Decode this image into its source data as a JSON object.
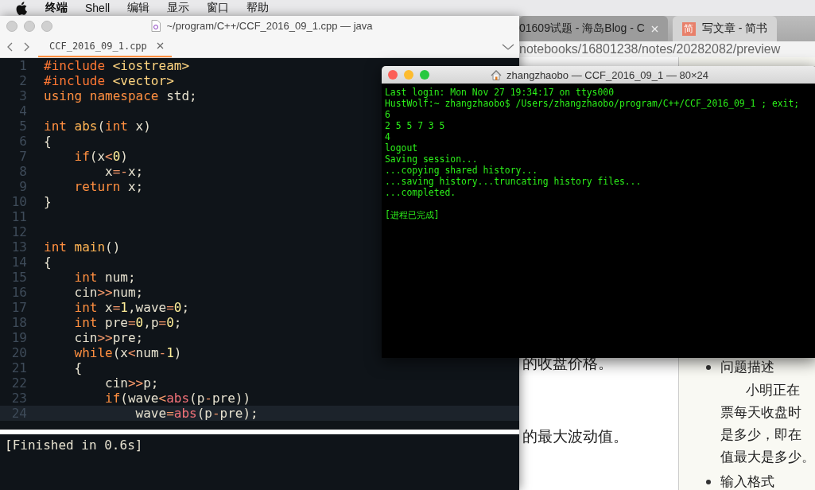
{
  "menu_bar": {
    "items": [
      {
        "label": "终端",
        "kind": "app"
      },
      {
        "label": "Shell",
        "kind": "menu"
      },
      {
        "label": "编辑",
        "kind": "menu"
      },
      {
        "label": "显示",
        "kind": "menu"
      },
      {
        "label": "窗口",
        "kind": "menu"
      },
      {
        "label": "帮助",
        "kind": "menu"
      }
    ]
  },
  "browser": {
    "tabs": [
      {
        "label": "01609试题 - 海岛Blog - C",
        "selected": false
      },
      {
        "label": "写文章 - 简书",
        "favicon": "简",
        "selected": true
      }
    ],
    "address": "notebooks/16801238/notes/20282082/preview",
    "article": {
      "lines": [
        "的收盘价格。",
        "的最大波动值。"
      ]
    },
    "preview": {
      "sections": [
        {
          "heading": "问题描述",
          "paragraph": [
            "小明正在",
            "票每天收盘时",
            "是多少，即在",
            "值最大是多少。"
          ]
        },
        {
          "heading": "输入格式"
        }
      ]
    }
  },
  "editor": {
    "window_title": "~/program/C++/CCF_2016_09_1.cpp — java",
    "tabs": [
      {
        "label": "CCF_2016_09_1.cpp",
        "selected": true
      }
    ],
    "lines": [
      {
        "number": "1",
        "current": false,
        "tokens": [
          {
            "kind": "preproc",
            "text": "#include"
          },
          {
            "kind": "header",
            "text": " <iostream>"
          }
        ]
      },
      {
        "number": "2",
        "current": false,
        "tokens": [
          {
            "kind": "preproc",
            "text": "#include"
          },
          {
            "kind": "header",
            "text": " <vector>"
          }
        ]
      },
      {
        "number": "3",
        "current": false,
        "tokens": [
          {
            "kind": "keyword",
            "text": "using"
          },
          {
            "kind": "keyword",
            "text": " namespace"
          },
          {
            "kind": "plain",
            "text": " std;"
          }
        ]
      },
      {
        "number": "4",
        "current": false
      },
      {
        "number": "5",
        "current": false,
        "tokens": [
          {
            "kind": "keyword",
            "text": "int"
          },
          {
            "kind": "function",
            "text": " abs"
          },
          {
            "kind": "plain",
            "text": "("
          },
          {
            "kind": "keyword",
            "text": "int"
          },
          {
            "kind": "plain",
            "text": " x)"
          }
        ]
      },
      {
        "number": "6",
        "current": false,
        "tokens": [
          {
            "kind": "plain",
            "text": "{"
          }
        ]
      },
      {
        "number": "7",
        "current": false,
        "tokens": [
          {
            "kind": "keyword",
            "text": "    if"
          },
          {
            "kind": "plain",
            "text": "(x"
          },
          {
            "kind": "operator",
            "text": "<"
          },
          {
            "kind": "number",
            "text": "0"
          },
          {
            "kind": "plain",
            "text": ")"
          }
        ]
      },
      {
        "number": "8",
        "current": false,
        "tokens": [
          {
            "kind": "plain",
            "text": "        x"
          },
          {
            "kind": "operator",
            "text": "=-"
          },
          {
            "kind": "plain",
            "text": "x;"
          }
        ]
      },
      {
        "number": "9",
        "current": false,
        "tokens": [
          {
            "kind": "keyword",
            "text": "    return"
          },
          {
            "kind": "plain",
            "text": " x;"
          }
        ]
      },
      {
        "number": "10",
        "current": false,
        "tokens": [
          {
            "kind": "plain",
            "text": "}"
          }
        ]
      },
      {
        "number": "11",
        "current": false
      },
      {
        "number": "12",
        "current": false
      },
      {
        "number": "13",
        "current": false,
        "tokens": [
          {
            "kind": "keyword",
            "text": "int"
          },
          {
            "kind": "function",
            "text": " main"
          },
          {
            "kind": "plain",
            "text": "()"
          }
        ]
      },
      {
        "number": "14",
        "current": false,
        "tokens": [
          {
            "kind": "plain",
            "text": "{"
          }
        ]
      },
      {
        "number": "15",
        "current": false,
        "tokens": [
          {
            "kind": "keyword",
            "text": "    int"
          },
          {
            "kind": "plain",
            "text": " num;"
          }
        ]
      },
      {
        "number": "16",
        "current": false,
        "tokens": [
          {
            "kind": "plain",
            "text": "    cin"
          },
          {
            "kind": "operator",
            "text": ">>"
          },
          {
            "kind": "plain",
            "text": "num;"
          }
        ]
      },
      {
        "number": "17",
        "current": false,
        "tokens": [
          {
            "kind": "keyword",
            "text": "    int"
          },
          {
            "kind": "plain",
            "text": " x"
          },
          {
            "kind": "operator",
            "text": "="
          },
          {
            "kind": "number",
            "text": "1"
          },
          {
            "kind": "plain",
            "text": ",wave"
          },
          {
            "kind": "operator",
            "text": "="
          },
          {
            "kind": "number",
            "text": "0"
          },
          {
            "kind": "plain",
            "text": ";"
          }
        ]
      },
      {
        "number": "18",
        "current": false,
        "tokens": [
          {
            "kind": "keyword",
            "text": "    int"
          },
          {
            "kind": "plain",
            "text": " pre"
          },
          {
            "kind": "operator",
            "text": "="
          },
          {
            "kind": "number",
            "text": "0"
          },
          {
            "kind": "plain",
            "text": ",p"
          },
          {
            "kind": "operator",
            "text": "="
          },
          {
            "kind": "number",
            "text": "0"
          },
          {
            "kind": "plain",
            "text": ";"
          }
        ]
      },
      {
        "number": "19",
        "current": false,
        "tokens": [
          {
            "kind": "plain",
            "text": "    cin"
          },
          {
            "kind": "operator",
            "text": ">>"
          },
          {
            "kind": "plain",
            "text": "pre;"
          }
        ]
      },
      {
        "number": "20",
        "current": false,
        "tokens": [
          {
            "kind": "keyword",
            "text": "    while"
          },
          {
            "kind": "plain",
            "text": "(x"
          },
          {
            "kind": "operator",
            "text": "<"
          },
          {
            "kind": "plain",
            "text": "num"
          },
          {
            "kind": "operator",
            "text": "-"
          },
          {
            "kind": "number",
            "text": "1"
          },
          {
            "kind": "plain",
            "text": ")"
          }
        ]
      },
      {
        "number": "21",
        "current": false,
        "tokens": [
          {
            "kind": "plain",
            "text": "    {"
          }
        ]
      },
      {
        "number": "22",
        "current": false,
        "tokens": [
          {
            "kind": "plain",
            "text": "        cin"
          },
          {
            "kind": "operator",
            "text": ">>"
          },
          {
            "kind": "plain",
            "text": "p;"
          }
        ]
      },
      {
        "number": "23",
        "current": false,
        "tokens": [
          {
            "kind": "keyword",
            "text": "        if"
          },
          {
            "kind": "plain",
            "text": "(wave"
          },
          {
            "kind": "operator",
            "text": "<"
          },
          {
            "kind": "call",
            "text": "abs"
          },
          {
            "kind": "plain",
            "text": "(p"
          },
          {
            "kind": "operator",
            "text": "-"
          },
          {
            "kind": "plain",
            "text": "pre))"
          }
        ]
      },
      {
        "number": "24",
        "current": true,
        "tokens": [
          {
            "kind": "plain",
            "text": "            wave"
          },
          {
            "kind": "operator",
            "text": "="
          },
          {
            "kind": "call",
            "text": "abs"
          },
          {
            "kind": "plain",
            "text": "(p"
          },
          {
            "kind": "operator",
            "text": "-"
          },
          {
            "kind": "plain",
            "text": "pre);"
          }
        ]
      }
    ],
    "build_output": "[Finished in 0.6s]"
  },
  "terminal": {
    "window_title": "zhangzhaobo — CCF_2016_09_1 — 80×24",
    "output": [
      "Last login: Mon Nov 27 19:34:17 on ttys000",
      "HustWolf:~ zhangzhaobo$ /Users/zhangzhaobo/program/C++/CCF_2016_09_1 ; exit;",
      "6",
      "2 5 5 7 3 5",
      "4",
      "logout",
      "Saving session...",
      "...copying shared history...",
      "...saving history...truncating history files...",
      "...completed."
    ],
    "status": "[进程已完成]"
  }
}
